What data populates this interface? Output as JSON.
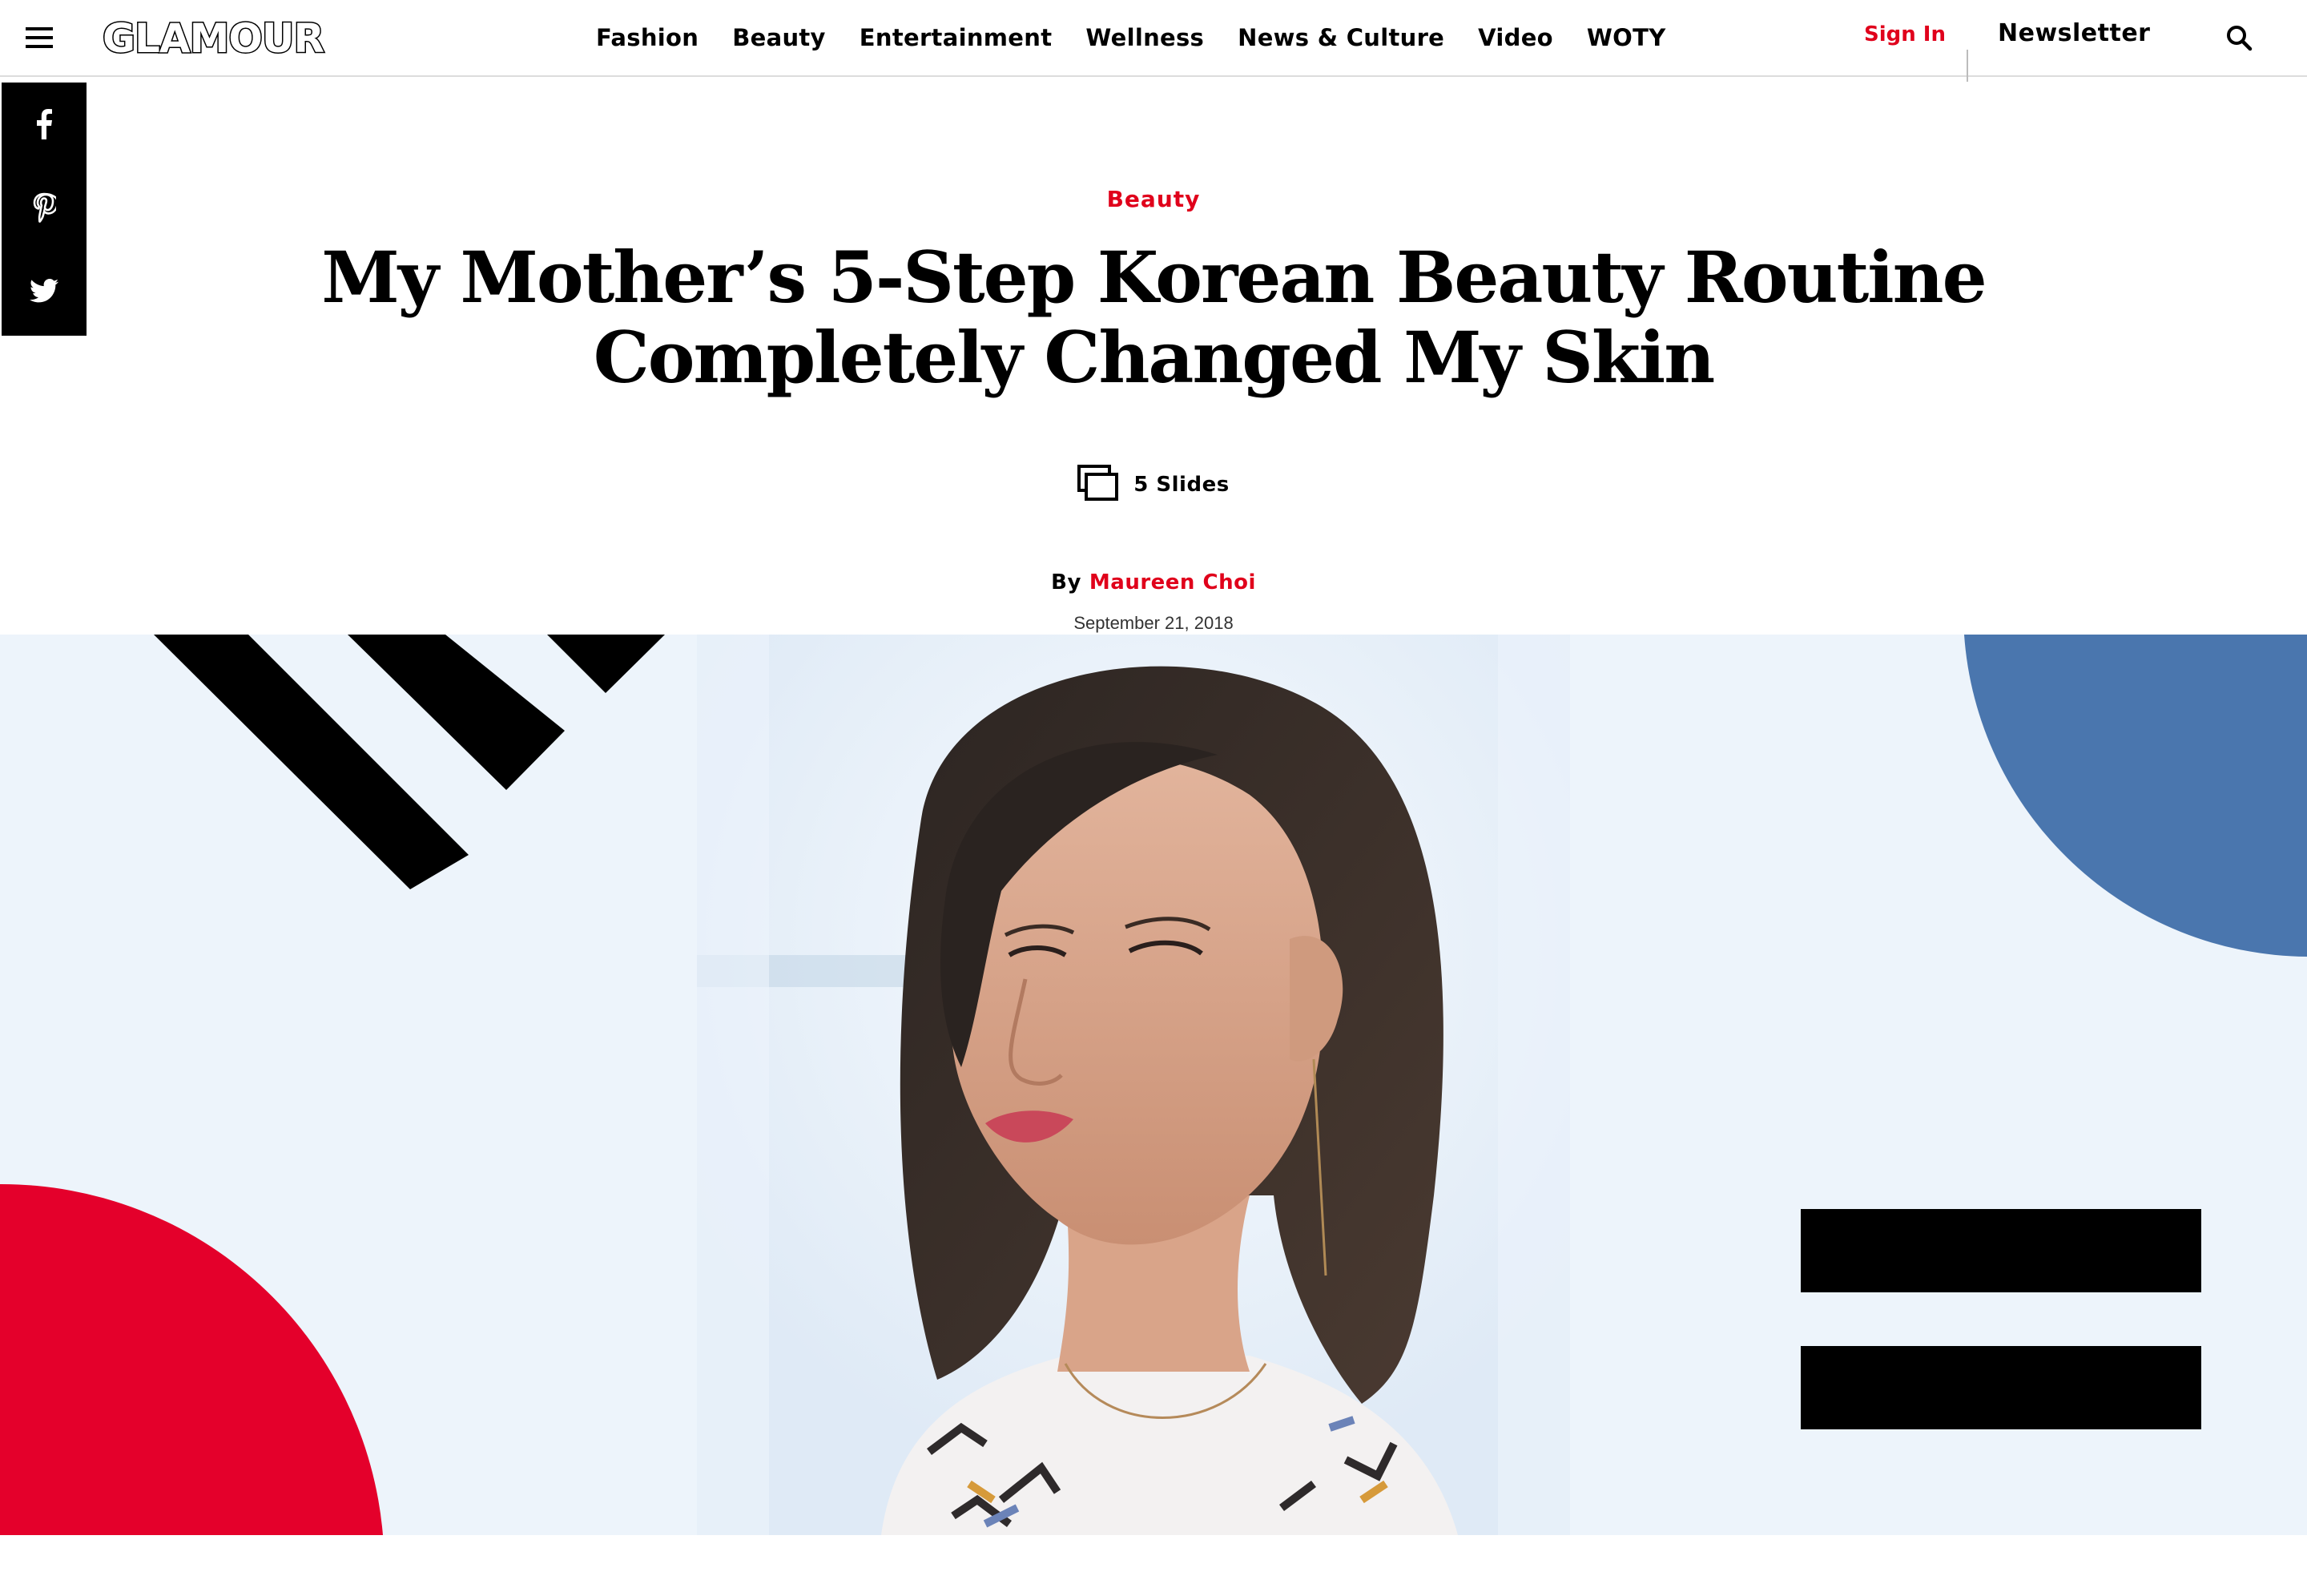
{
  "header": {
    "logo": "GLAMOUR",
    "nav": [
      "Fashion",
      "Beauty",
      "Entertainment",
      "Wellness",
      "News & Culture",
      "Video",
      "WOTY"
    ],
    "sign_in": "Sign In",
    "newsletter": "Newsletter",
    "icons": [
      "menu-icon",
      "search-icon"
    ]
  },
  "share": {
    "icons": [
      "facebook-icon",
      "pinterest-icon",
      "twitter-icon"
    ]
  },
  "article": {
    "rubric": "Beauty",
    "title": "My Mother’s 5-Step Korean Beauty Routine Completely Changed My Skin",
    "slides_label": "5 Slides",
    "byline_prefix": "By",
    "author": "Maureen Choi",
    "date": "September 21, 2018"
  },
  "colors": {
    "accent_red": "#e0001b",
    "hero_background": "#edf4fb",
    "hero_blue": "#4a76ae",
    "hero_red": "#e4002b",
    "hero_black": "#000000"
  },
  "hero": {
    "description_icon": "woman-portrait-image"
  }
}
